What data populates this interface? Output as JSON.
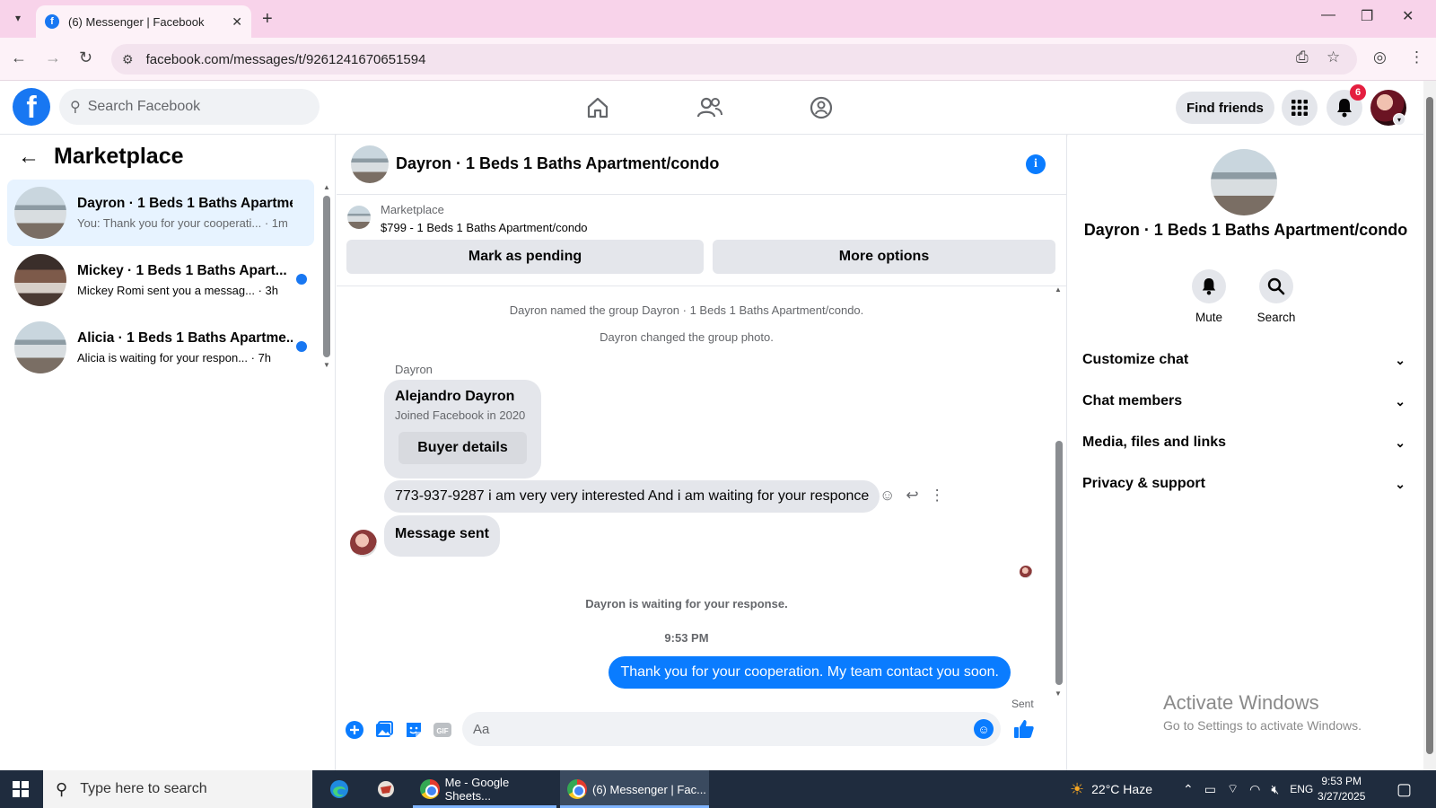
{
  "browser": {
    "tab_title": "(6) Messenger | Facebook",
    "url": "facebook.com/messages/t/9261241670651594"
  },
  "fb_header": {
    "search_placeholder": "Search Facebook",
    "find_friends": "Find friends",
    "notification_count": "6"
  },
  "left": {
    "title": "Marketplace",
    "conversations": [
      {
        "name": "Dayron · 1 Beds 1 Baths Apartme...",
        "snippet": "You: Thank you for your cooperati... · 1m",
        "unread": false,
        "active": true
      },
      {
        "name": "Mickey · 1 Beds 1 Baths Apart...",
        "snippet": "Mickey Romi sent you a messag... · 3h",
        "unread": true,
        "active": false
      },
      {
        "name": "Alicia · 1 Beds 1 Baths Apartme...",
        "snippet": "Alicia is waiting for your respon... · 7h",
        "unread": true,
        "active": false
      }
    ]
  },
  "chat": {
    "title": "Dayron · 1 Beds 1 Baths Apartment/condo",
    "listing_label": "Marketplace",
    "listing_price": "$799 - 1 Beds 1 Baths Apartment/condo",
    "mark_pending": "Mark as pending",
    "more_options": "More options",
    "sys_named": "Dayron named the group Dayron · 1 Beds 1 Baths Apartment/condo.",
    "sys_photo": "Dayron changed the group photo.",
    "sender": "Dayron",
    "card_name": "Alejandro Dayron",
    "card_joined": "Joined Facebook in 2020",
    "buyer_details": "Buyer details",
    "incoming_msg": "773-937-9287 i am very very interested And i am waiting for your responce",
    "message_sent": "Message sent",
    "waiting": "Dayron is waiting for your response.",
    "time": "9:53 PM",
    "outgoing_msg": "Thank you for your cooperation. My team contact you soon.",
    "sent_status": "Sent",
    "composer_placeholder": "Aa"
  },
  "right": {
    "title": "Dayron · 1 Beds 1 Baths Apartment/condo",
    "mute": "Mute",
    "search": "Search",
    "sections": [
      "Customize chat",
      "Chat members",
      "Media, files and links",
      "Privacy & support"
    ],
    "activate_title": "Activate Windows",
    "activate_sub": "Go to Settings to activate Windows."
  },
  "taskbar": {
    "search_placeholder": "Type here to search",
    "app1": "Me - Google Sheets...",
    "app2": "(6) Messenger | Fac...",
    "weather": "22°C  Haze",
    "lang": "ENG",
    "time": "9:53 PM",
    "date": "3/27/2025"
  },
  "colors": {
    "fb_blue": "#1877f2",
    "messenger_blue": "#0a7cff",
    "active_conv_bg": "#e7f3ff",
    "tabbar_pink": "#f8d3ea"
  }
}
